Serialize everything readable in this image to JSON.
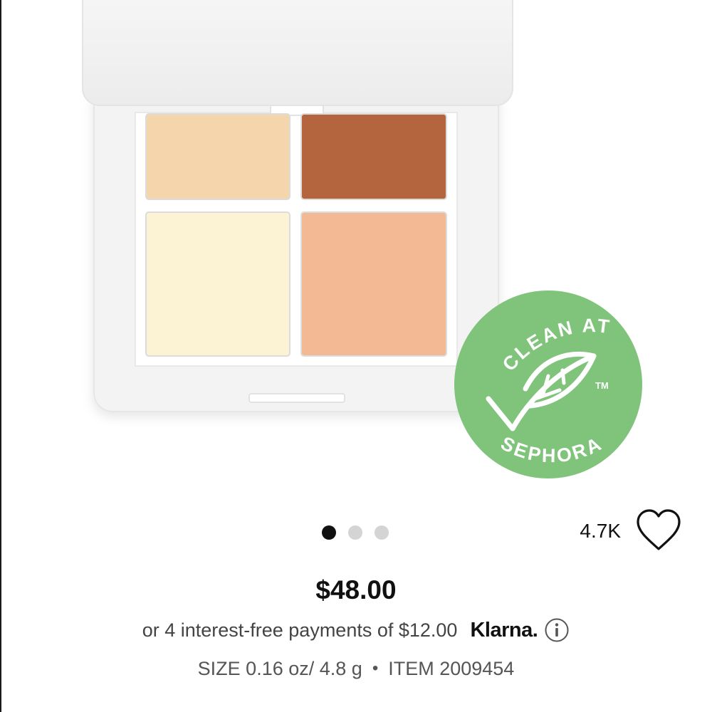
{
  "product": {
    "image": {
      "swatch_colors": [
        "#f5d6ac",
        "#b4653d",
        "#fcf2d4",
        "#f3b995"
      ],
      "badge": {
        "top_text": "CLEAN AT",
        "bottom_text": "SEPHORA",
        "trademark": "TM",
        "color": "#80c47c"
      }
    },
    "carousel": {
      "total": 3,
      "active_index": 0
    },
    "loves_count": "4.7K",
    "price": "$48.00",
    "payments_text": "or 4 interest-free payments of $12.00",
    "klarna_label": "Klarna.",
    "size_text": "SIZE 0.16 oz/ 4.8 g",
    "separator": "•",
    "item_text": "ITEM 2009454"
  },
  "icons": {
    "heart": "heart-outline-icon",
    "info": "info-circle-icon",
    "leaf": "leaf-check-icon"
  }
}
